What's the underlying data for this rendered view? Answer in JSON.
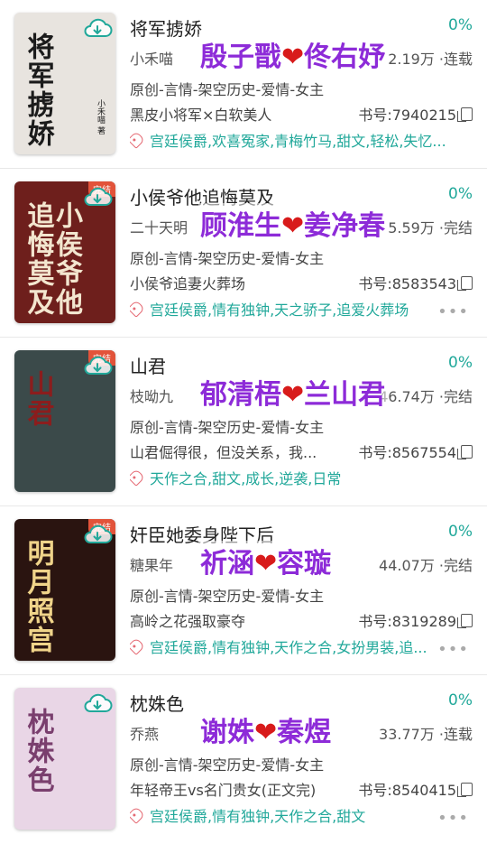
{
  "books": [
    {
      "title": "将军掳娇",
      "progress": "0%",
      "author": "小禾喵",
      "stats": "2.19万 ·连载",
      "overlay": {
        "left": "殷子戬",
        "heart": "❤",
        "right": "佟右妤"
      },
      "categories": "原创-言情-架空历史-爱情-女主",
      "description": "黑皮小将军×白软美人",
      "book_no": "书号:7940215",
      "tags": "宫廷侯爵,欢喜冤家,青梅竹马,甜文,轻松,失忆...",
      "cover": {
        "title": "将军掳娇",
        "author": "小禾喵 著",
        "badge": "",
        "bg": "#e8e4df",
        "fg": "#1b1b1b"
      },
      "show_more": false
    },
    {
      "title": "小侯爷他追悔莫及",
      "progress": "0%",
      "author": "二十天明",
      "stats": "5.59万 ·完结",
      "overlay": {
        "left": "顾淮生",
        "heart": "❤",
        "right": "姜净春"
      },
      "categories": "原创-言情-架空历史-爱情-女主",
      "description": "小侯爷追妻火葬场",
      "book_no": "书号:8583543",
      "tags": "宫廷侯爵,情有独钟,天之骄子,追爱火葬场",
      "cover": {
        "title": "小侯爷他追悔莫及",
        "author": "",
        "badge": "完结",
        "bg": "#6e1f1c",
        "fg": "#f3e6cf"
      },
      "show_more": true
    },
    {
      "title": "山君",
      "progress": "0%",
      "author": "枝呦九",
      "stats": "46.74万 ·完结",
      "overlay": {
        "left": "郁清梧",
        "heart": "❤",
        "right": "兰山君"
      },
      "categories": "原创-言情-架空历史-爱情-女主",
      "description": "山君倔得很，但没关系，我...",
      "book_no": "书号:8567554",
      "tags": "天作之合,甜文,成长,逆袭,日常",
      "cover": {
        "title": "山君",
        "author": "",
        "badge": "完结",
        "bg": "#3b4a4a",
        "fg": "#8b1d1d"
      },
      "show_more": false
    },
    {
      "title": "奸臣她委身陛下后",
      "progress": "0%",
      "author": "糖果年",
      "stats": "44.07万 ·完结",
      "overlay": {
        "left": "祈涵",
        "heart": "❤",
        "right": "容璇"
      },
      "categories": "原创-言情-架空历史-爱情-女主",
      "description": "高岭之花强取豪夺",
      "book_no": "书号:8319289",
      "tags": "宫廷侯爵,情有独钟,天作之合,女扮男装,追...",
      "cover": {
        "title": "明月照宫",
        "author": "",
        "badge": "完结",
        "bg": "#2a1410",
        "fg": "#f0d48a"
      },
      "show_more": true
    },
    {
      "title": "枕姝色",
      "progress": "0%",
      "author": "乔燕",
      "stats": "33.77万 ·连载",
      "overlay": {
        "left": "谢姝",
        "heart": "❤",
        "right": "秦煜"
      },
      "categories": "原创-言情-架空历史-爱情-女主",
      "description": "年轻帝王vs名门贵女(正文完)",
      "book_no": "书号:8540415",
      "tags": "宫廷侯爵,情有独钟,天作之合,甜文",
      "cover": {
        "title": "枕姝色",
        "author": "",
        "badge": "",
        "bg": "#e9d6e6",
        "fg": "#7a3f6e"
      },
      "show_more": true
    }
  ],
  "icons": {
    "cloud": "cloud-download-icon",
    "tag": "tag-icon",
    "copy": "copy-icon",
    "more": "more-icon"
  },
  "colors": {
    "accent": "#21a89a",
    "overlay": "#8d2bd8",
    "heart": "#d81b1b",
    "tag_icon": "#e56a74"
  }
}
